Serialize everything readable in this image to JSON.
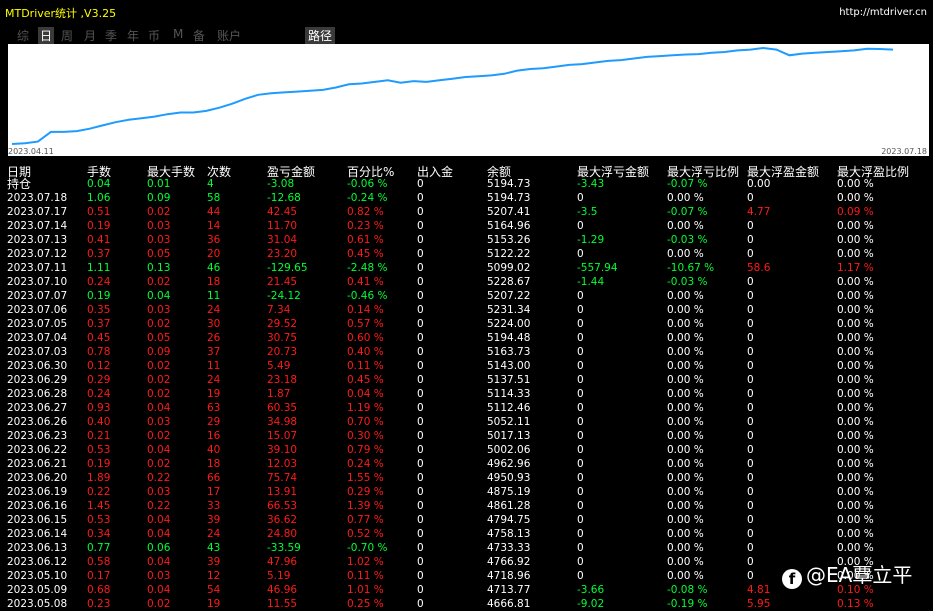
{
  "app": {
    "title": "MTDriver统计 ,V3.25",
    "url": "http://mtdriver.cn"
  },
  "tabs": [
    {
      "label": "综",
      "active": false
    },
    {
      "label": "日",
      "active": true
    },
    {
      "label": "周",
      "active": false
    },
    {
      "label": "月",
      "active": false
    },
    {
      "label": "季",
      "active": false
    },
    {
      "label": "年",
      "active": false
    },
    {
      "label": "币",
      "active": false
    },
    {
      "label": "M",
      "active": false
    },
    {
      "label": "备",
      "active": false
    },
    {
      "label": "账户",
      "active": false
    },
    {
      "label": "路径",
      "active": false
    }
  ],
  "chart_data": {
    "type": "line",
    "x_start_label": "2023.04.11",
    "x_end_label": "2023.07.18",
    "line_color": "#1e9bff",
    "values": [
      4030,
      4040,
      4060,
      4180,
      4180,
      4190,
      4220,
      4260,
      4300,
      4330,
      4350,
      4370,
      4400,
      4420,
      4420,
      4440,
      4480,
      4530,
      4590,
      4640,
      4660,
      4670,
      4680,
      4690,
      4700,
      4730,
      4770,
      4780,
      4800,
      4820,
      4790,
      4810,
      4800,
      4820,
      4840,
      4860,
      4870,
      4880,
      4900,
      4940,
      4960,
      4970,
      4990,
      5010,
      5020,
      5040,
      5060,
      5070,
      5090,
      5110,
      5120,
      5130,
      5140,
      5145,
      5160,
      5170,
      5190,
      5200,
      5220,
      5200,
      5130,
      5150,
      5160,
      5170,
      5180,
      5190,
      5210,
      5208,
      5200
    ]
  },
  "table": {
    "columns": [
      "日期",
      "手数",
      "最大手数",
      "次数",
      "盈亏金额",
      "百分比%",
      "出入金",
      "余额",
      "最大浮亏金额",
      "最大浮亏比例",
      "最大浮盈金额",
      "最大浮盈比例"
    ],
    "rows": [
      {
        "date": "持仓",
        "lots": "0.04",
        "maxlots": "0.01",
        "count": "4",
        "pnl": "-3.08",
        "pct": "-0.06 %",
        "io": "0",
        "bal": "5194.73",
        "maxloss": "-3.43",
        "maxlosspct": "-0.07 %",
        "maxprofit": "0.00",
        "maxprofitpct": "0.00 %",
        "color": "green",
        "d_color": "white",
        "ml_color": "green",
        "mp_color": "white"
      },
      {
        "date": "2023.07.18",
        "lots": "1.06",
        "maxlots": "0.09",
        "count": "58",
        "pnl": "-12.68",
        "pct": "-0.24 %",
        "io": "0",
        "bal": "5194.73",
        "maxloss": "0",
        "maxlosspct": "0.00 %",
        "maxprofit": "0",
        "maxprofitpct": "0.00 %",
        "color": "green",
        "d_color": "white",
        "ml_color": "white",
        "mp_color": "white"
      },
      {
        "date": "2023.07.17",
        "lots": "0.51",
        "maxlots": "0.02",
        "count": "44",
        "pnl": "42.45",
        "pct": "0.82 %",
        "io": "0",
        "bal": "5207.41",
        "maxloss": "-3.5",
        "maxlosspct": "-0.07 %",
        "maxprofit": "4.77",
        "maxprofitpct": "0.09 %",
        "color": "red",
        "d_color": "white",
        "ml_color": "green",
        "mp_color": "red"
      },
      {
        "date": "2023.07.14",
        "lots": "0.19",
        "maxlots": "0.03",
        "count": "14",
        "pnl": "11.70",
        "pct": "0.23 %",
        "io": "0",
        "bal": "5164.96",
        "maxloss": "0",
        "maxlosspct": "0.00 %",
        "maxprofit": "0",
        "maxprofitpct": "0.00 %",
        "color": "red",
        "d_color": "white",
        "ml_color": "white",
        "mp_color": "white"
      },
      {
        "date": "2023.07.13",
        "lots": "0.41",
        "maxlots": "0.03",
        "count": "36",
        "pnl": "31.04",
        "pct": "0.61 %",
        "io": "0",
        "bal": "5153.26",
        "maxloss": "-1.29",
        "maxlosspct": "-0.03 %",
        "maxprofit": "0",
        "maxprofitpct": "0.00 %",
        "color": "red",
        "d_color": "white",
        "ml_color": "green",
        "mp_color": "white"
      },
      {
        "date": "2023.07.12",
        "lots": "0.37",
        "maxlots": "0.05",
        "count": "20",
        "pnl": "23.20",
        "pct": "0.45 %",
        "io": "0",
        "bal": "5122.22",
        "maxloss": "0",
        "maxlosspct": "0.00 %",
        "maxprofit": "0",
        "maxprofitpct": "0.00 %",
        "color": "red",
        "d_color": "white",
        "ml_color": "white",
        "mp_color": "white"
      },
      {
        "date": "2023.07.11",
        "lots": "1.11",
        "maxlots": "0.13",
        "count": "46",
        "pnl": "-129.65",
        "pct": "-2.48 %",
        "io": "0",
        "bal": "5099.02",
        "maxloss": "-557.94",
        "maxlosspct": "-10.67 %",
        "maxprofit": "58.6",
        "maxprofitpct": "1.17 %",
        "color": "green",
        "d_color": "white",
        "ml_color": "green",
        "mp_color": "red"
      },
      {
        "date": "2023.07.10",
        "lots": "0.24",
        "maxlots": "0.02",
        "count": "18",
        "pnl": "21.45",
        "pct": "0.41 %",
        "io": "0",
        "bal": "5228.67",
        "maxloss": "-1.44",
        "maxlosspct": "-0.03 %",
        "maxprofit": "0",
        "maxprofitpct": "0.00 %",
        "color": "red",
        "d_color": "white",
        "ml_color": "green",
        "mp_color": "white"
      },
      {
        "date": "2023.07.07",
        "lots": "0.19",
        "maxlots": "0.04",
        "count": "11",
        "pnl": "-24.12",
        "pct": "-0.46 %",
        "io": "0",
        "bal": "5207.22",
        "maxloss": "0",
        "maxlosspct": "0.00 %",
        "maxprofit": "0",
        "maxprofitpct": "0.00 %",
        "color": "green",
        "d_color": "white",
        "ml_color": "white",
        "mp_color": "white"
      },
      {
        "date": "2023.07.06",
        "lots": "0.35",
        "maxlots": "0.03",
        "count": "24",
        "pnl": "7.34",
        "pct": "0.14 %",
        "io": "0",
        "bal": "5231.34",
        "maxloss": "0",
        "maxlosspct": "0.00 %",
        "maxprofit": "0",
        "maxprofitpct": "0.00 %",
        "color": "red",
        "d_color": "white",
        "ml_color": "white",
        "mp_color": "white"
      },
      {
        "date": "2023.07.05",
        "lots": "0.37",
        "maxlots": "0.02",
        "count": "30",
        "pnl": "29.52",
        "pct": "0.57 %",
        "io": "0",
        "bal": "5224.00",
        "maxloss": "0",
        "maxlosspct": "0.00 %",
        "maxprofit": "0",
        "maxprofitpct": "0.00 %",
        "color": "red",
        "d_color": "white",
        "ml_color": "white",
        "mp_color": "white"
      },
      {
        "date": "2023.07.04",
        "lots": "0.45",
        "maxlots": "0.05",
        "count": "26",
        "pnl": "30.75",
        "pct": "0.60 %",
        "io": "0",
        "bal": "5194.48",
        "maxloss": "0",
        "maxlosspct": "0.00 %",
        "maxprofit": "0",
        "maxprofitpct": "0.00 %",
        "color": "red",
        "d_color": "white",
        "ml_color": "white",
        "mp_color": "white"
      },
      {
        "date": "2023.07.03",
        "lots": "0.78",
        "maxlots": "0.09",
        "count": "37",
        "pnl": "20.73",
        "pct": "0.40 %",
        "io": "0",
        "bal": "5163.73",
        "maxloss": "0",
        "maxlosspct": "0.00 %",
        "maxprofit": "0",
        "maxprofitpct": "0.00 %",
        "color": "red",
        "d_color": "white",
        "ml_color": "white",
        "mp_color": "white"
      },
      {
        "date": "2023.06.30",
        "lots": "0.12",
        "maxlots": "0.02",
        "count": "11",
        "pnl": "5.49",
        "pct": "0.11 %",
        "io": "0",
        "bal": "5143.00",
        "maxloss": "0",
        "maxlosspct": "0.00 %",
        "maxprofit": "0",
        "maxprofitpct": "0.00 %",
        "color": "red",
        "d_color": "white",
        "ml_color": "white",
        "mp_color": "white"
      },
      {
        "date": "2023.06.29",
        "lots": "0.29",
        "maxlots": "0.02",
        "count": "24",
        "pnl": "23.18",
        "pct": "0.45 %",
        "io": "0",
        "bal": "5137.51",
        "maxloss": "0",
        "maxlosspct": "0.00 %",
        "maxprofit": "0",
        "maxprofitpct": "0.00 %",
        "color": "red",
        "d_color": "white",
        "ml_color": "white",
        "mp_color": "white"
      },
      {
        "date": "2023.06.28",
        "lots": "0.24",
        "maxlots": "0.02",
        "count": "19",
        "pnl": "1.87",
        "pct": "0.04 %",
        "io": "0",
        "bal": "5114.33",
        "maxloss": "0",
        "maxlosspct": "0.00 %",
        "maxprofit": "0",
        "maxprofitpct": "0.00 %",
        "color": "red",
        "d_color": "white",
        "ml_color": "white",
        "mp_color": "white"
      },
      {
        "date": "2023.06.27",
        "lots": "0.93",
        "maxlots": "0.04",
        "count": "63",
        "pnl": "60.35",
        "pct": "1.19 %",
        "io": "0",
        "bal": "5112.46",
        "maxloss": "0",
        "maxlosspct": "0.00 %",
        "maxprofit": "0",
        "maxprofitpct": "0.00 %",
        "color": "red",
        "d_color": "white",
        "ml_color": "white",
        "mp_color": "white"
      },
      {
        "date": "2023.06.26",
        "lots": "0.40",
        "maxlots": "0.03",
        "count": "29",
        "pnl": "34.98",
        "pct": "0.70 %",
        "io": "0",
        "bal": "5052.11",
        "maxloss": "0",
        "maxlosspct": "0.00 %",
        "maxprofit": "0",
        "maxprofitpct": "0.00 %",
        "color": "red",
        "d_color": "white",
        "ml_color": "white",
        "mp_color": "white"
      },
      {
        "date": "2023.06.23",
        "lots": "0.21",
        "maxlots": "0.02",
        "count": "16",
        "pnl": "15.07",
        "pct": "0.30 %",
        "io": "0",
        "bal": "5017.13",
        "maxloss": "0",
        "maxlosspct": "0.00 %",
        "maxprofit": "0",
        "maxprofitpct": "0.00 %",
        "color": "red",
        "d_color": "white",
        "ml_color": "white",
        "mp_color": "white"
      },
      {
        "date": "2023.06.22",
        "lots": "0.53",
        "maxlots": "0.04",
        "count": "40",
        "pnl": "39.10",
        "pct": "0.79 %",
        "io": "0",
        "bal": "5002.06",
        "maxloss": "0",
        "maxlosspct": "0.00 %",
        "maxprofit": "0",
        "maxprofitpct": "0.00 %",
        "color": "red",
        "d_color": "white",
        "ml_color": "white",
        "mp_color": "white"
      },
      {
        "date": "2023.06.21",
        "lots": "0.19",
        "maxlots": "0.02",
        "count": "18",
        "pnl": "12.03",
        "pct": "0.24 %",
        "io": "0",
        "bal": "4962.96",
        "maxloss": "0",
        "maxlosspct": "0.00 %",
        "maxprofit": "0",
        "maxprofitpct": "0.00 %",
        "color": "red",
        "d_color": "white",
        "ml_color": "white",
        "mp_color": "white"
      },
      {
        "date": "2023.06.20",
        "lots": "1.89",
        "maxlots": "0.22",
        "count": "66",
        "pnl": "75.74",
        "pct": "1.55 %",
        "io": "0",
        "bal": "4950.93",
        "maxloss": "0",
        "maxlosspct": "0.00 %",
        "maxprofit": "0",
        "maxprofitpct": "0.00 %",
        "color": "red",
        "d_color": "white",
        "ml_color": "white",
        "mp_color": "white"
      },
      {
        "date": "2023.06.19",
        "lots": "0.22",
        "maxlots": "0.03",
        "count": "17",
        "pnl": "13.91",
        "pct": "0.29 %",
        "io": "0",
        "bal": "4875.19",
        "maxloss": "0",
        "maxlosspct": "0.00 %",
        "maxprofit": "0",
        "maxprofitpct": "0.00 %",
        "color": "red",
        "d_color": "white",
        "ml_color": "white",
        "mp_color": "white"
      },
      {
        "date": "2023.06.16",
        "lots": "1.45",
        "maxlots": "0.22",
        "count": "33",
        "pnl": "66.53",
        "pct": "1.39 %",
        "io": "0",
        "bal": "4861.28",
        "maxloss": "0",
        "maxlosspct": "0.00 %",
        "maxprofit": "0",
        "maxprofitpct": "0.00 %",
        "color": "red",
        "d_color": "white",
        "ml_color": "white",
        "mp_color": "white"
      },
      {
        "date": "2023.06.15",
        "lots": "0.53",
        "maxlots": "0.04",
        "count": "39",
        "pnl": "36.62",
        "pct": "0.77 %",
        "io": "0",
        "bal": "4794.75",
        "maxloss": "0",
        "maxlosspct": "0.00 %",
        "maxprofit": "0",
        "maxprofitpct": "0.00 %",
        "color": "red",
        "d_color": "white",
        "ml_color": "white",
        "mp_color": "white"
      },
      {
        "date": "2023.06.14",
        "lots": "0.34",
        "maxlots": "0.04",
        "count": "24",
        "pnl": "24.80",
        "pct": "0.52 %",
        "io": "0",
        "bal": "4758.13",
        "maxloss": "0",
        "maxlosspct": "0.00 %",
        "maxprofit": "0",
        "maxprofitpct": "0.00 %",
        "color": "red",
        "d_color": "white",
        "ml_color": "white",
        "mp_color": "white"
      },
      {
        "date": "2023.06.13",
        "lots": "0.77",
        "maxlots": "0.06",
        "count": "43",
        "pnl": "-33.59",
        "pct": "-0.70 %",
        "io": "0",
        "bal": "4733.33",
        "maxloss": "0",
        "maxlosspct": "0.00 %",
        "maxprofit": "0",
        "maxprofitpct": "0.00 %",
        "color": "green",
        "d_color": "white",
        "ml_color": "white",
        "mp_color": "white"
      },
      {
        "date": "2023.06.12",
        "lots": "0.58",
        "maxlots": "0.04",
        "count": "39",
        "pnl": "47.96",
        "pct": "1.02 %",
        "io": "0",
        "bal": "4766.92",
        "maxloss": "0",
        "maxlosspct": "0.00 %",
        "maxprofit": "0",
        "maxprofitpct": "0.00 %",
        "color": "red",
        "d_color": "white",
        "ml_color": "white",
        "mp_color": "white"
      },
      {
        "date": "2023.05.10",
        "lots": "0.17",
        "maxlots": "0.03",
        "count": "12",
        "pnl": "5.19",
        "pct": "0.11 %",
        "io": "0",
        "bal": "4718.96",
        "maxloss": "0",
        "maxlosspct": "0.00 %",
        "maxprofit": "0",
        "maxprofitpct": "0.00 %",
        "color": "red",
        "d_color": "white",
        "ml_color": "white",
        "mp_color": "white"
      },
      {
        "date": "2023.05.09",
        "lots": "0.68",
        "maxlots": "0.04",
        "count": "54",
        "pnl": "46.96",
        "pct": "1.01 %",
        "io": "0",
        "bal": "4713.77",
        "maxloss": "-3.66",
        "maxlosspct": "-0.08 %",
        "maxprofit": "4.81",
        "maxprofitpct": "0.10 %",
        "color": "red",
        "d_color": "white",
        "ml_color": "green",
        "mp_color": "red"
      },
      {
        "date": "2023.05.08",
        "lots": "0.23",
        "maxlots": "0.02",
        "count": "19",
        "pnl": "11.55",
        "pct": "0.25 %",
        "io": "0",
        "bal": "4666.81",
        "maxloss": "-9.02",
        "maxlosspct": "-0.19 %",
        "maxprofit": "5.95",
        "maxprofitpct": "0.13 %",
        "color": "red",
        "d_color": "white",
        "ml_color": "green",
        "mp_color": "red"
      }
    ]
  },
  "watermark": {
    "icon": "facebook-icon",
    "text": "@EA覃立平"
  }
}
